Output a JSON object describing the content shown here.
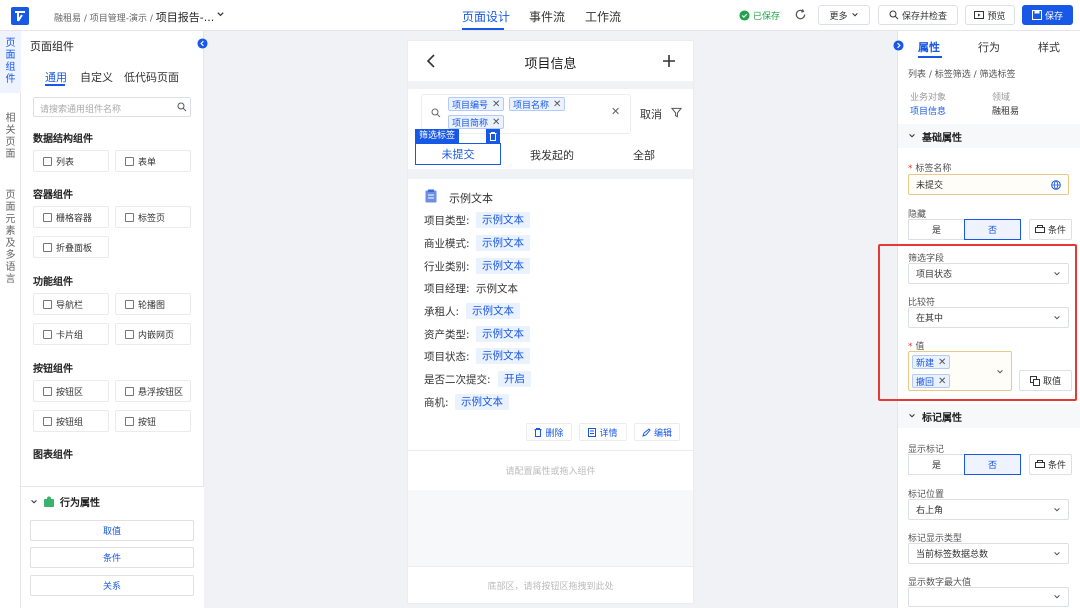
{
  "header": {
    "crumb_prefix": "融租易 / 项目管理-演示 /",
    "crumb_current": "项目报告-...",
    "tabs": [
      "页面设计",
      "事件流",
      "工作流"
    ],
    "saved_text": "已保存",
    "more": "更多",
    "save_check": "保存并检查",
    "preview": "预览",
    "save": "保存"
  },
  "vnav": [
    "页面组件",
    "相关页面",
    "页面元素及多语言"
  ],
  "left": {
    "title": "页面组件",
    "tabs": [
      "通用",
      "自定义",
      "低代码页面"
    ],
    "search_placeholder": "请搜索通用组件名称",
    "sections": [
      {
        "title": "数据结构组件",
        "items": [
          "列表",
          "表单"
        ]
      },
      {
        "title": "容器组件",
        "items": [
          "栅格容器",
          "标签页",
          "折叠面板"
        ]
      },
      {
        "title": "功能组件",
        "items": [
          "导航栏",
          "轮播图",
          "卡片组",
          "内嵌网页"
        ]
      },
      {
        "title": "按钮组件",
        "items": [
          "按钮区",
          "悬浮按钮区",
          "按钮组",
          "按钮"
        ]
      },
      {
        "title": "图表组件",
        "items": []
      }
    ],
    "behavior_title": "行为属性",
    "behavior_buttons": [
      "取值",
      "条件",
      "关系"
    ]
  },
  "phone": {
    "title": "项目信息",
    "filter_tags": [
      "项目编号",
      "项目名称",
      "项目简称"
    ],
    "cancel": "取消",
    "filter_label": "筛选标签",
    "tabs": [
      "未提交",
      "我发起的",
      "全部"
    ],
    "card_title": "示例文本",
    "fields": [
      {
        "label": "项目类型:",
        "value": "示例文本",
        "hl": true
      },
      {
        "label": "商业模式:",
        "value": "示例文本",
        "hl": true
      },
      {
        "label": "行业类别:",
        "value": "示例文本",
        "hl": true
      },
      {
        "label": "项目经理:",
        "value": "示例文本",
        "hl": false
      },
      {
        "label": "承租人:",
        "value": "示例文本",
        "hl": true
      },
      {
        "label": "资产类型:",
        "value": "示例文本",
        "hl": true
      },
      {
        "label": "项目状态:",
        "value": "示例文本",
        "hl": true
      },
      {
        "label": "是否二次提交:",
        "value": "开启",
        "hl": true
      },
      {
        "label": "商机:",
        "value": "示例文本",
        "hl": true
      }
    ],
    "actions": [
      "删除",
      "详情",
      "编辑"
    ],
    "hint": "请配置属性或拖入组件",
    "footer": "底部区，请将按钮区拖拽到此处"
  },
  "right": {
    "tabs": [
      "属性",
      "行为",
      "样式"
    ],
    "crumb": "列表 / 标签筛选 / 筛选标签",
    "biz_label": "业务对象",
    "biz_value": "项目信息",
    "domain_label": "领域",
    "domain_value": "融租易",
    "basic_title": "基础属性",
    "tag_name_label": "标签名称",
    "tag_name_value": "未提交",
    "hide_label": "隐藏",
    "yes": "是",
    "no": "否",
    "condition": "条件",
    "filter_field_label": "筛选字段",
    "filter_field_value": "项目状态",
    "comparator_label": "比较符",
    "comparator_value": "在其中",
    "value_label": "值",
    "value_tags": [
      "新建",
      "撤回"
    ],
    "take_value": "取值",
    "mark_title": "标记属性",
    "show_mark_label": "显示标记",
    "mark_pos_label": "标记位置",
    "mark_pos_value": "右上角",
    "mark_type_label": "标记显示类型",
    "mark_type_value": "当前标签数据总数",
    "max_label": "显示数字最大值"
  },
  "colors": {
    "accent": "#1858e6",
    "highlight": "#e53935",
    "success": "#22a34b"
  }
}
